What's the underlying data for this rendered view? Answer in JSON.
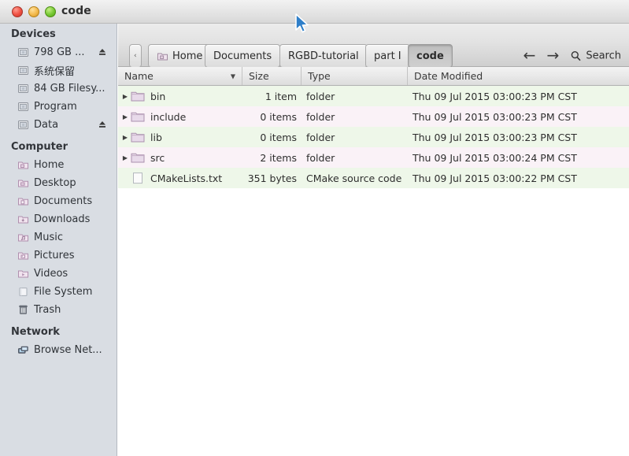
{
  "window": {
    "title": "code",
    "buttons": {
      "close": "close-button",
      "minimize": "minimize-button",
      "maximize": "maximize-button"
    }
  },
  "sidebar": {
    "groups": [
      {
        "title": "Devices",
        "items": [
          {
            "label": "798 GB ...",
            "icon": "drive-icon",
            "eject": true
          },
          {
            "label": "系统保留",
            "icon": "drive-icon",
            "eject": false
          },
          {
            "label": "84 GB Filesy...",
            "icon": "drive-icon",
            "eject": false
          },
          {
            "label": "Program",
            "icon": "drive-icon",
            "eject": false
          },
          {
            "label": "Data",
            "icon": "drive-icon",
            "eject": true
          }
        ]
      },
      {
        "title": "Computer",
        "items": [
          {
            "label": "Home",
            "icon": "folder-home-icon",
            "eject": false
          },
          {
            "label": "Desktop",
            "icon": "folder-desktop-icon",
            "eject": false
          },
          {
            "label": "Documents",
            "icon": "folder-documents-icon",
            "eject": false
          },
          {
            "label": "Downloads",
            "icon": "folder-downloads-icon",
            "eject": false
          },
          {
            "label": "Music",
            "icon": "folder-music-icon",
            "eject": false
          },
          {
            "label": "Pictures",
            "icon": "folder-pictures-icon",
            "eject": false
          },
          {
            "label": "Videos",
            "icon": "folder-videos-icon",
            "eject": false
          },
          {
            "label": "File System",
            "icon": "filesystem-icon",
            "eject": false
          },
          {
            "label": "Trash",
            "icon": "trash-icon",
            "eject": false
          }
        ]
      },
      {
        "title": "Network",
        "items": [
          {
            "label": "Browse Net...",
            "icon": "network-icon",
            "eject": false
          }
        ]
      }
    ]
  },
  "toolbar": {
    "overflow_label": "‹",
    "breadcrumbs": [
      {
        "label": "Home",
        "icon": "folder-home-icon",
        "current": false
      },
      {
        "label": "Documents",
        "icon": "",
        "current": false
      },
      {
        "label": "RGBD-tutorial",
        "icon": "",
        "current": false
      },
      {
        "label": "part I",
        "icon": "",
        "current": false
      },
      {
        "label": "code",
        "icon": "",
        "current": true
      }
    ],
    "back_label": "←",
    "forward_label": "→",
    "search_label": "Search"
  },
  "filelist": {
    "columns": [
      {
        "key": "name",
        "label": "Name",
        "sorted": true
      },
      {
        "key": "size",
        "label": "Size",
        "sorted": false
      },
      {
        "key": "type",
        "label": "Type",
        "sorted": false
      },
      {
        "key": "date",
        "label": "Date Modified",
        "sorted": false
      }
    ],
    "sort_caret": "▼",
    "disclosure_glyph": "▶",
    "rows": [
      {
        "name": "bin",
        "size": "1 item",
        "type": "folder",
        "date": "Thu 09 Jul 2015 03:00:23 PM CST",
        "icon": "folder-icon",
        "expandable": true
      },
      {
        "name": "include",
        "size": "0 items",
        "type": "folder",
        "date": "Thu 09 Jul 2015 03:00:23 PM CST",
        "icon": "folder-icon",
        "expandable": true
      },
      {
        "name": "lib",
        "size": "0 items",
        "type": "folder",
        "date": "Thu 09 Jul 2015 03:00:23 PM CST",
        "icon": "folder-icon",
        "expandable": true
      },
      {
        "name": "src",
        "size": "2 items",
        "type": "folder",
        "date": "Thu 09 Jul 2015 03:00:24 PM CST",
        "icon": "folder-icon",
        "expandable": true
      },
      {
        "name": "CMakeLists.txt",
        "size": "351 bytes",
        "type": "CMake source code",
        "date": "Thu 09 Jul 2015 03:00:22 PM CST",
        "icon": "text-file-icon",
        "expandable": false
      }
    ]
  },
  "colors": {
    "sidebar_bg": "#d9dde3",
    "row_odd": "#eef7e9",
    "row_even": "#faf2f7",
    "titlebar_top": "#f2f2f2",
    "accent_close": "#ef4f41",
    "accent_min": "#f3b94b",
    "accent_max": "#76c833",
    "cursor": "#2f7fc9"
  }
}
